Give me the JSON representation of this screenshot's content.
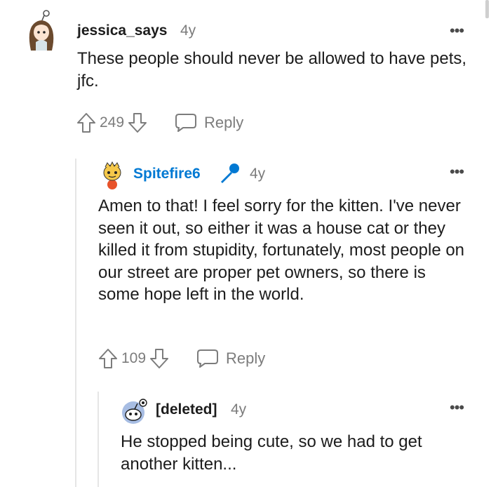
{
  "comments": [
    {
      "author": "jessica_says",
      "time": "4y",
      "body": "These people should never be allowed to have pets, jfc.",
      "score": "249",
      "reply_label": "Reply",
      "more_label": "•••"
    },
    {
      "author": "Spitefire6",
      "time": "4y",
      "body": "Amen to that! I feel sorry for the kitten. I've never seen it out, so either it was a house cat or they killed it from stupidity, fortunately, most people on our street are proper pet owners, so there is some hope left in the world.",
      "score": "109",
      "reply_label": "Reply",
      "more_label": "•••",
      "author_color": "#0079d3"
    },
    {
      "author": "[deleted]",
      "time": "4y",
      "body": "He stopped being cute, so we had to get another kitten...",
      "more_label": "•••"
    }
  ]
}
